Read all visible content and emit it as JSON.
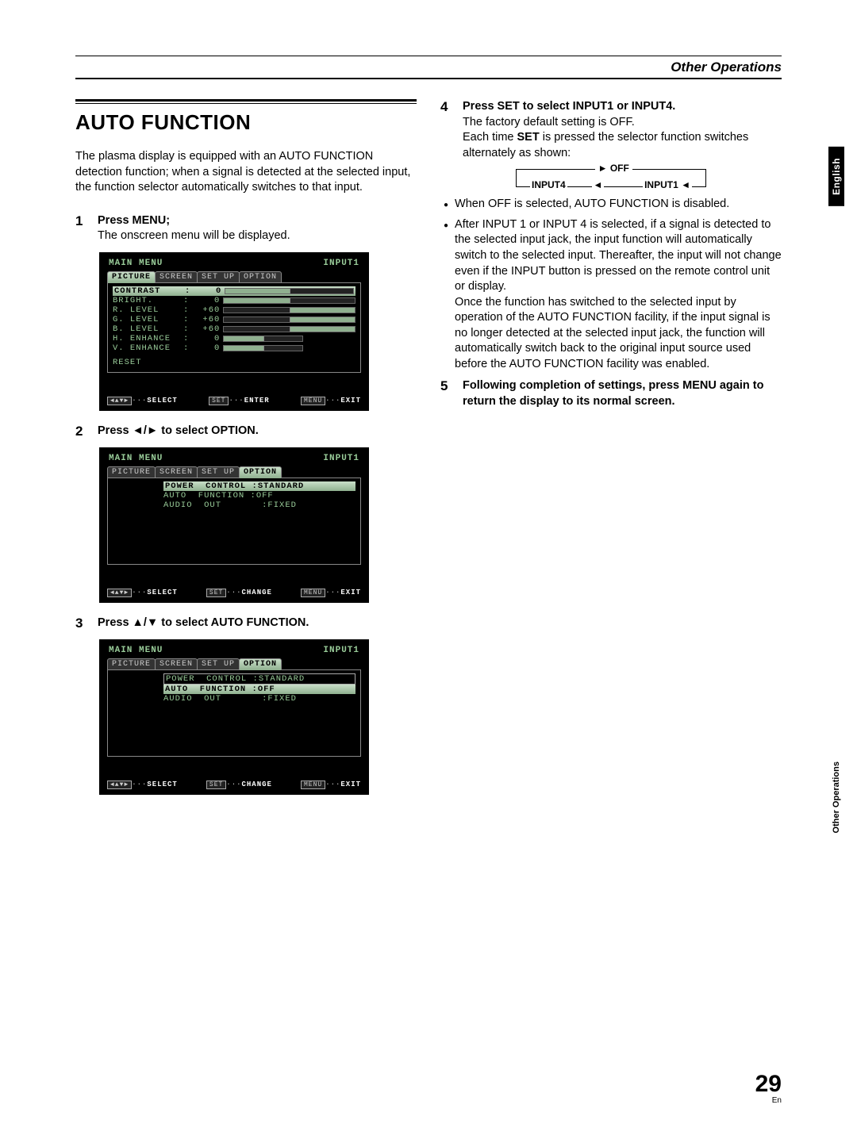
{
  "header": {
    "section": "Other Operations"
  },
  "title": "AUTO FUNCTION",
  "intro": "The plasma display is equipped with an AUTO FUNCTION detection function; when a signal is detected at the selected input, the function selector automatically switches to that input.",
  "step1": {
    "num": "1",
    "head": "Press MENU;",
    "sub": "The onscreen menu will be displayed."
  },
  "step2": {
    "num": "2",
    "head_pre": "Press ",
    "head_arrows": "◄/►",
    "head_post": " to select OPTION."
  },
  "step3": {
    "num": "3",
    "head_pre": "Press ",
    "head_arrows": "▲/▼",
    "head_post": " to select AUTO FUNCTION."
  },
  "step4": {
    "num": "4",
    "head": "Press SET to select INPUT1 or INPUT4.",
    "line1": "The factory default setting is OFF.",
    "line2a": "Each time ",
    "line2b": "SET",
    "line2c": " is pressed the selector function switches alternately as shown:"
  },
  "cycle": {
    "off": "OFF",
    "in4": "INPUT4",
    "in1": "INPUT1"
  },
  "bullet1": "When OFF is selected, AUTO FUNCTION is disabled.",
  "bullet2": "After INPUT 1 or INPUT 4 is selected, if a signal is detected to the selected input jack, the input function will automatically switch to the selected input. Thereafter, the input will not change even if the INPUT button is pressed on the remote control unit or display.",
  "bullet2b": "Once the function has switched to the selected input by operation of the AUTO FUNCTION facility, if the input signal is no longer detected at the selected input jack, the function will automatically switch back to the original input source used before the AUTO FUNCTION facility was enabled.",
  "step5": {
    "num": "5",
    "head": "Following completion of settings, press MENU again to return the display to its normal screen."
  },
  "osd": {
    "main_menu": "MAIN  MENU",
    "input_label": "INPUT1",
    "tabs": {
      "picture": "PICTURE",
      "screen": "SCREEN",
      "setup": "SET UP",
      "option": "OPTION"
    },
    "rows": {
      "contrast": {
        "label": "CONTRAST",
        "val": "0"
      },
      "bright": {
        "label": "BRIGHT.",
        "val": "0"
      },
      "rlevel": {
        "label": "R. LEVEL",
        "val": "+60"
      },
      "glevel": {
        "label": "G. LEVEL",
        "val": "+60"
      },
      "blevel": {
        "label": "B. LEVEL",
        "val": "+60"
      },
      "henh": {
        "label": "H. ENHANCE",
        "val": "0"
      },
      "venh": {
        "label": "V. ENHANCE",
        "val": "0"
      }
    },
    "reset": "RESET",
    "opt": {
      "power": "POWER  CONTROL :STANDARD",
      "auto": "AUTO  FUNCTION :OFF",
      "audio": "AUDIO  OUT       :FIXED"
    },
    "foot": {
      "select": "SELECT",
      "set": "SET",
      "enter": "ENTER",
      "change": "CHANGE",
      "menu": "MENU",
      "exit": "EXIT"
    }
  },
  "sideTab": "English",
  "sideLabel": "Other Operations",
  "pageNum": "29",
  "pageLang": "En"
}
